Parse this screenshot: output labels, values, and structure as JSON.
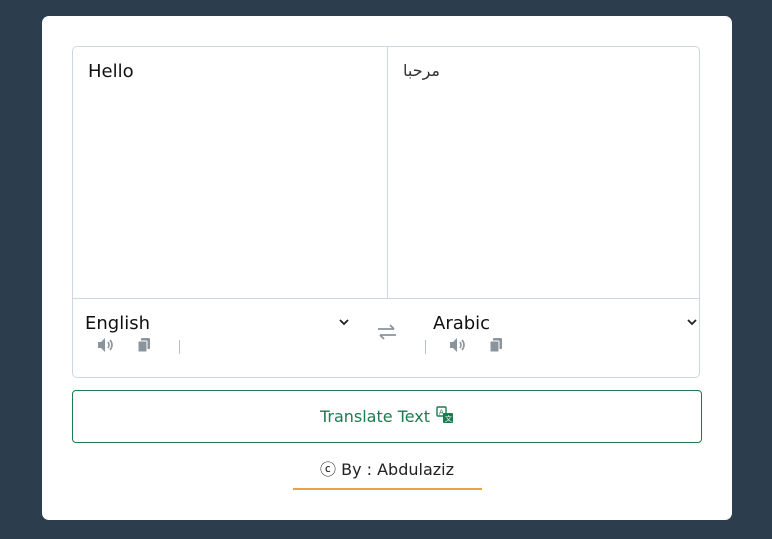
{
  "input": {
    "from_text": "Hello",
    "to_text": "مرحبا"
  },
  "languages": {
    "from": "English",
    "to": "Arabic"
  },
  "button": {
    "label": "Translate Text"
  },
  "footer": {
    "credit": "ⓒ By : Abdulaziz"
  },
  "colors": {
    "background": "#2c3e4e",
    "accent": "#1e7a4f",
    "underline": "#f0a04b"
  },
  "icons": {
    "speak": "volume-icon",
    "copy": "copy-icon",
    "swap": "swap-arrows-icon",
    "translate": "translate-icon"
  }
}
